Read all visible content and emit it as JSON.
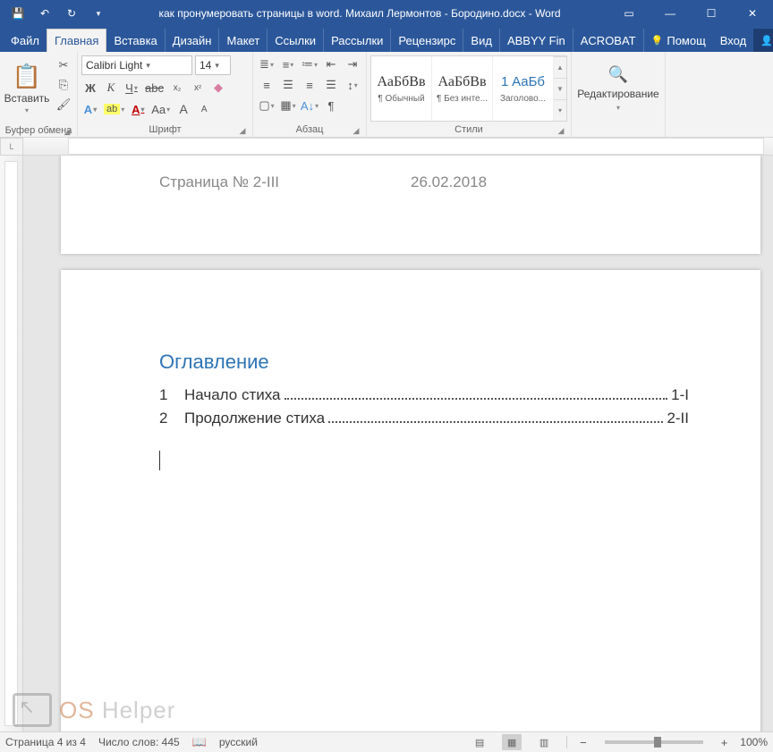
{
  "title": "как пронумеровать страницы в word. Михаил Лермонтов - Бородино.docx - Word",
  "tabs": {
    "file": "Файл",
    "home": "Главная",
    "insert": "Вставка",
    "design": "Дизайн",
    "layout": "Макет",
    "references": "Ссылки",
    "mailings": "Рассылки",
    "review": "Рецензирс",
    "view": "Вид",
    "abbyy": "ABBYY Fin",
    "acrobat": "ACROBAT",
    "help": "Помощ",
    "signin": "Вход",
    "share": "Общий доступ"
  },
  "ribbon": {
    "clipboard": {
      "label": "Буфер обмена",
      "paste": "Вставить"
    },
    "font": {
      "label": "Шрифт",
      "name": "Calibri Light",
      "size": "14",
      "bold": "Ж",
      "italic": "К",
      "underline": "Ч",
      "strike": "abc",
      "sub": "x",
      "sup": "x",
      "case": "Aa",
      "grow": "A",
      "shrink": "A",
      "effects": "A",
      "hilite": "ab",
      "color": "A"
    },
    "paragraph": {
      "label": "Абзац"
    },
    "styles": {
      "label": "Стили",
      "sample": "АаБбВв",
      "sample_h": "АаБб",
      "s1": "¶ Обычный",
      "s2": "¶ Без инте...",
      "s3": "Заголово...",
      "num": "1"
    },
    "editing": {
      "label": "Редактирование"
    }
  },
  "document": {
    "header_left": "Страница № 2-III",
    "header_right": "26.02.2018",
    "toc_title": "Оглавление",
    "toc": [
      {
        "n": "1",
        "t": "Начало стиха",
        "p": "1-I"
      },
      {
        "n": "2",
        "t": "Продолжение стиха",
        "p": "2-II"
      }
    ]
  },
  "status": {
    "page": "Страница 4 из 4",
    "words": "Число слов: 445",
    "lang": "русский",
    "zoom": "100%"
  },
  "watermark": {
    "a": "OS",
    "b": "Helper"
  }
}
